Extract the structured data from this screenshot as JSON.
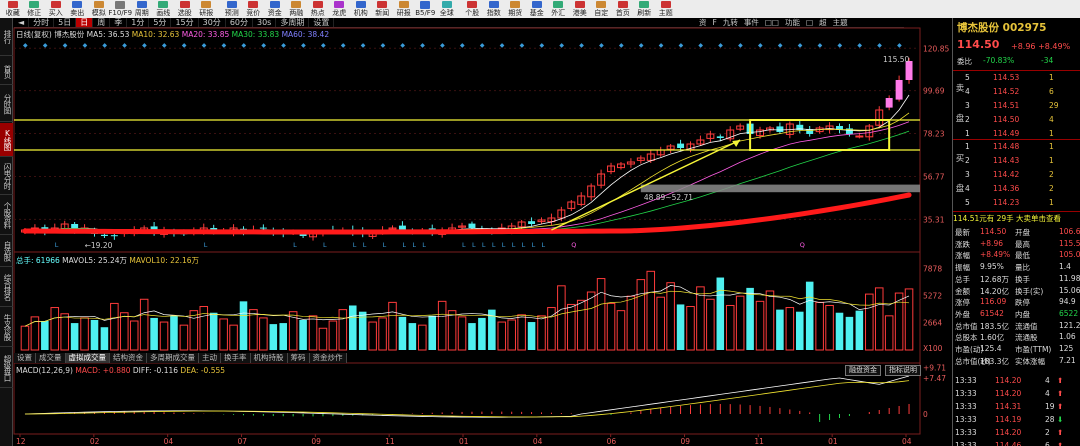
{
  "toolbar": [
    "收藏",
    "修正",
    "买入",
    "卖出",
    "模拟",
    "F10/F9",
    "周期",
    "画线",
    "选股",
    "研报",
    "预测",
    "竞价",
    "资金",
    "两融",
    "热点",
    "龙虎",
    "机构",
    "新闻",
    "研报",
    "B5/F9",
    "全球",
    "个股",
    "指数",
    "期货",
    "基金",
    "外汇",
    "港美",
    "自定",
    "首页",
    "刷新",
    "主题"
  ],
  "periods": [
    "分时",
    "5日",
    "日",
    "周",
    "季",
    "1分",
    "5分",
    "15分",
    "30分",
    "60分",
    "30s",
    "多周期",
    "设置"
  ],
  "period_selected": "日",
  "right_tabs": [
    "资",
    "F",
    "九转",
    "事件",
    "□□",
    "功能",
    "□",
    "超",
    "主题"
  ],
  "left_tabs": [
    "排行",
    "首页",
    "分时图",
    "K线图",
    "闪电分时",
    "个股资料",
    "自选股",
    "综合排名",
    "牛叉诊股",
    "超级盘口"
  ],
  "left_selected": "K线图",
  "ma_line": {
    "label": "日线(复权)",
    "stock": "博杰股份",
    "ma5": "MA5: 36.53",
    "ma10": "MA10: 32.63",
    "ma20": "MA20: 33.85",
    "ma30": "MA30: 33.83",
    "ma60": "MA60: 38.42"
  },
  "price_axis": [
    "120.85",
    "99.69",
    "78.23",
    "56.77",
    "35.31"
  ],
  "vol_axis": [
    "7878",
    "5272",
    "2664",
    "X100"
  ],
  "macd_axis": [
    "+9.71",
    "+7.47",
    "0"
  ],
  "annot": {
    "peak": "115.50",
    "low": "19.20",
    "range": "48.89~52.71"
  },
  "date_axis": [
    "12",
    "02",
    "04",
    "07",
    "09",
    "11",
    "01",
    "04",
    "06",
    "09",
    "11",
    "01",
    "04"
  ],
  "vol_info": {
    "a": "总手: 61966",
    "b": "MAVOL5: 25.24万",
    "c": "MAVOL10: 22.16万"
  },
  "sub_tabs": [
    "设置",
    "成交量",
    "虚拟成交量",
    "结构资金",
    "多周期成交量",
    "主动",
    "换手率",
    "机构持股",
    "筹码",
    "资金炒作"
  ],
  "sub_tab_selected": "虚拟成交量",
  "macd_info": {
    "a": "MACD(12,26,9)",
    "b": "MACD: +0.880",
    "c": "DIFF: -0.116",
    "d": "DEA: -0.555"
  },
  "macd_buttons": [
    "融盘资金",
    "指标说明"
  ],
  "quote": {
    "name": "博杰股份 002975",
    "price": "114.50",
    "change": "+8.96",
    "pct": "+8.49%",
    "weibi_label": "委比",
    "weibi": "-70.83%",
    "weicha": "-34",
    "asks": [
      [
        "5",
        "114.53",
        "1"
      ],
      [
        "4",
        "114.52",
        "6"
      ],
      [
        "3",
        "114.51",
        "29"
      ],
      [
        "2",
        "114.50",
        "4"
      ],
      [
        "1",
        "114.49",
        "1"
      ]
    ],
    "bids": [
      [
        "1",
        "114.48",
        "1"
      ],
      [
        "2",
        "114.43",
        "1"
      ],
      [
        "3",
        "114.42",
        "2"
      ],
      [
        "4",
        "114.36",
        "2"
      ],
      [
        "5",
        "114.23",
        "1"
      ]
    ],
    "sell_label": "卖",
    "buy_label": "买",
    "pan_label": "盘",
    "tape_note": "114.51元有 29手 大卖单击查看",
    "stats": [
      [
        "最新",
        "114.50",
        "开盘",
        "106.6"
      ],
      [
        "涨跌",
        "+8.96",
        "最高",
        "115.5"
      ],
      [
        "涨幅",
        "+8.49%",
        "最低",
        "105.0"
      ],
      [
        "振幅",
        "9.95%",
        "量比",
        "1.4"
      ],
      [
        "总手",
        "12.68万",
        "换手",
        "11.98"
      ],
      [
        "金额",
        "14.20亿",
        "换手(实)",
        "15.06"
      ],
      [
        "涨停",
        "116.09",
        "跌停",
        "94.9"
      ],
      [
        "外盘",
        "61542",
        "内盘",
        "6522"
      ],
      [
        "总市值",
        "183.5亿",
        "流通值",
        "121.2"
      ],
      [
        "总股本",
        "1.60亿",
        "流通股",
        "1.06"
      ],
      [
        "市盈(动)",
        "125.4",
        "市盈(TTM)",
        "125"
      ],
      [
        "总市值(秒)",
        "183.3亿",
        "实体涨幅",
        "7.21"
      ]
    ],
    "ticks": [
      [
        "13:33",
        "114.20",
        "4",
        "up"
      ],
      [
        "13:33",
        "114.20",
        "4",
        "up"
      ],
      [
        "13:33",
        "114.31",
        "19",
        "up"
      ],
      [
        "13:33",
        "114.19",
        "28",
        "dn"
      ],
      [
        "13:33",
        "114.20",
        "2",
        "up"
      ],
      [
        "13:33",
        "114.46",
        "6",
        "up"
      ]
    ]
  },
  "colors": {
    "up": "#ff3b3b",
    "down": "#4ff0f0",
    "ma5": "#ffffff",
    "ma10": "#f2e430",
    "ma20": "#ff5ee6",
    "ma30": "#22d54a",
    "ma60": "#8080ff",
    "box": "#f5f538",
    "redcurve": "#ff1a1a"
  },
  "chart_data": {
    "type": "candlestick",
    "price_axis_ticks": [
      120.85,
      99.69,
      78.23,
      56.77,
      35.31
    ],
    "ylim": [
      20,
      125
    ],
    "x_date_labels": [
      "12",
      "02",
      "04",
      "07",
      "09",
      "11",
      "01",
      "04",
      "06",
      "09",
      "11",
      "01",
      "04"
    ],
    "last_close": 114.5,
    "peak_label": 115.5,
    "low_label": 19.2,
    "box_range": [
      70,
      85
    ],
    "grey_band_label": "48.89~52.71",
    "closes": [
      30,
      31,
      29,
      31,
      33,
      30,
      31,
      28,
      27,
      27,
      29,
      30,
      31,
      29,
      30,
      28,
      28,
      30,
      31,
      29,
      30,
      31,
      29,
      30,
      31,
      29,
      28,
      29,
      27,
      28,
      29,
      30,
      30,
      29,
      28,
      29,
      30,
      31,
      30,
      29,
      30,
      29,
      30,
      31,
      32,
      31,
      30,
      29,
      31,
      32,
      34,
      33,
      35,
      36,
      40,
      44,
      47,
      52,
      58,
      62,
      63,
      64,
      66,
      68,
      70,
      72,
      71,
      73,
      75,
      78,
      76,
      80,
      82,
      78,
      80,
      81,
      79,
      83,
      80,
      78,
      81,
      82,
      80,
      78,
      77,
      82,
      90,
      96,
      105,
      114.5
    ],
    "volumes": [
      2300,
      3200,
      2800,
      4100,
      3500,
      2600,
      3100,
      2900,
      2200,
      4500,
      3600,
      2800,
      4900,
      3100,
      2700,
      3300,
      2400,
      3800,
      4200,
      3600,
      3000,
      2400,
      4700,
      3900,
      3100,
      2500,
      2600,
      3700,
      2900,
      3300,
      2100,
      2800,
      3900,
      4300,
      3700,
      2700,
      3100,
      4600,
      3200,
      2600,
      2400,
      3300,
      4700,
      3800,
      3200,
      2600,
      3100,
      3900,
      2700,
      2900,
      3400,
      2700,
      3300,
      4100,
      6200,
      4400,
      4800,
      5600,
      6900,
      4500,
      3800,
      5200,
      6800,
      7600,
      5100,
      6500,
      4400,
      4200,
      6100,
      4900,
      7000,
      4300,
      5200,
      6000,
      4700,
      5700,
      3900,
      4100,
      3700,
      6600,
      4600,
      4300,
      3600,
      3200,
      3800,
      5400,
      6000,
      3300,
      5500,
      5900
    ],
    "vol_axis_ticks": [
      7878,
      5272,
      2664
    ],
    "macd_axis_ticks": [
      9.71,
      7.47,
      0
    ]
  }
}
